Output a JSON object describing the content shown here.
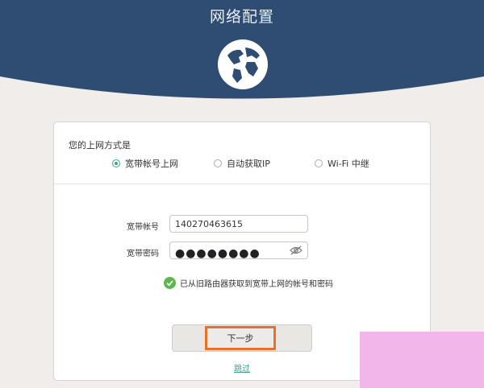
{
  "header": {
    "title": "网络配置"
  },
  "card": {
    "section_label": "您的上网方式是",
    "modes": [
      {
        "label": "宽带帐号上网",
        "selected": true
      },
      {
        "label": "自动获取IP",
        "selected": false
      },
      {
        "label": "Wi-Fi 中继",
        "selected": false
      }
    ],
    "account_label": "宽带帐号",
    "account_value": "140270463615",
    "password_label": "宽带密码",
    "password_mask": "●●●●●●●●",
    "status_text": "已从旧路由器获取到宽带上网的帐号和密码",
    "next_label": "下一步",
    "skip_label": "跳过"
  },
  "colors": {
    "header_bg": "#2f4c72",
    "accent_green": "#3aa58c",
    "highlight_orange": "#e7702b"
  }
}
